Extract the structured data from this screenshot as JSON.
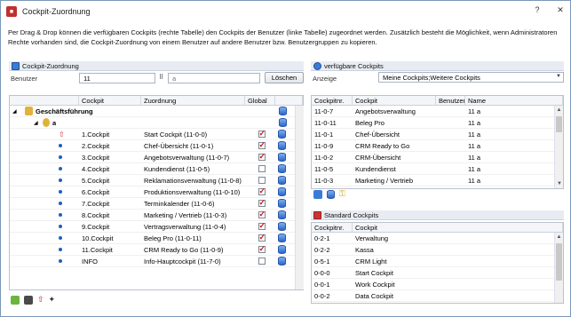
{
  "window": {
    "title": "Cockpit-Zuordnung",
    "help": "?",
    "close": "✕"
  },
  "description": "Per Drag & Drop können die verfügbaren Cockpits (rechte Tabelle) den Cockpits der Benutzer (linke Tabelle) zugeordnet werden. Zusätzlich besteht die Möglichkeit, wenn Administratoren Rechte vorhanden sind, die Cockpit-Zuordnung von einem Benutzer auf andere Benutzer bzw. Benutzergruppen zu kopieren.",
  "left": {
    "panel_title": "Cockpit-Zuordnung",
    "user_label": "Benutzer",
    "user_value": "11",
    "user_name": "a",
    "delete_button": "Löschen",
    "columns": [
      "Cockpit",
      "Zuordnung",
      "Global"
    ],
    "group": "Geschäftsführung",
    "user_node": "a",
    "rows": [
      {
        "cockpit": "1.Cockpit",
        "zuordnung": "Start Cockpit (11-0-0)",
        "global": true,
        "kind": "up"
      },
      {
        "cockpit": "2.Cockpit",
        "zuordnung": "Chef-Übersicht (11-0-1)",
        "global": true,
        "kind": "dot"
      },
      {
        "cockpit": "3.Cockpit",
        "zuordnung": "Angebotsverwaltung (11-0-7)",
        "global": true,
        "kind": "dot"
      },
      {
        "cockpit": "4.Cockpit",
        "zuordnung": "Kundendienst (11-0-5)",
        "global": false,
        "kind": "dot"
      },
      {
        "cockpit": "5.Cockpit",
        "zuordnung": "Reklamationsverwaltung (11-0-8)",
        "global": false,
        "kind": "dot"
      },
      {
        "cockpit": "6.Cockpit",
        "zuordnung": "Produktionsverwaltung (11-0-10)",
        "global": true,
        "kind": "dot"
      },
      {
        "cockpit": "7.Cockpit",
        "zuordnung": "Terminkalender (11-0-6)",
        "global": true,
        "kind": "dot"
      },
      {
        "cockpit": "8.Cockpit",
        "zuordnung": "Marketing / Vertrieb (11-0-3)",
        "global": true,
        "kind": "dot"
      },
      {
        "cockpit": "9.Cockpit",
        "zuordnung": "Vertragsverwaltung (11-0-4)",
        "global": true,
        "kind": "dot"
      },
      {
        "cockpit": "10.Cockpit",
        "zuordnung": "Beleg Pro (11-0-11)",
        "global": true,
        "kind": "dot"
      },
      {
        "cockpit": "11.Cockpit",
        "zuordnung": "CRM Ready to Go (11-0-9)",
        "global": true,
        "kind": "dot"
      },
      {
        "cockpit": "INFO",
        "zuordnung": "Info-Hauptcockpit (11-7-0)",
        "global": false,
        "kind": "dot"
      }
    ]
  },
  "right": {
    "panel_title": "verfügbare Cockpits",
    "anzeige_label": "Anzeige",
    "anzeige_value": "Meine Cockpits;Weitere Cockpits",
    "columns": [
      "Cockpitnr.",
      "Cockpit",
      "Benutzer",
      "Name"
    ],
    "rows": [
      {
        "nr": "11-0-7",
        "cockpit": "Angebotsverwaltung",
        "benutzer": "",
        "name": "11 a"
      },
      {
        "nr": "11-0-11",
        "cockpit": "Beleg Pro",
        "benutzer": "",
        "name": "11 a"
      },
      {
        "nr": "11-0-1",
        "cockpit": "Chef-Übersicht",
        "benutzer": "",
        "name": "11 a"
      },
      {
        "nr": "11-0-9",
        "cockpit": "CRM Ready to Go",
        "benutzer": "",
        "name": "11 a"
      },
      {
        "nr": "11-0-2",
        "cockpit": "CRM-Übersicht",
        "benutzer": "",
        "name": "11 a"
      },
      {
        "nr": "11-0-5",
        "cockpit": "Kundendienst",
        "benutzer": "",
        "name": "11 a"
      },
      {
        "nr": "11-0-3",
        "cockpit": "Marketing / Vertrieb",
        "benutzer": "",
        "name": "11 a"
      }
    ],
    "std_title": "Standard Cockpits",
    "std_columns": [
      "Cockpitnr.",
      "Cockpit"
    ],
    "std_rows": [
      {
        "nr": "0-2-1",
        "cockpit": "Verwaltung"
      },
      {
        "nr": "0-2-2",
        "cockpit": "Kassa"
      },
      {
        "nr": "0-5-1",
        "cockpit": "CRM Light"
      },
      {
        "nr": "0-0-0",
        "cockpit": "Start Cockpit"
      },
      {
        "nr": "0-0-1",
        "cockpit": "Work Cockpit"
      },
      {
        "nr": "0-0-2",
        "cockpit": "Data Cockpit"
      }
    ]
  },
  "colors": {
    "accent": "#3a7bd5",
    "check": "#cc1111",
    "header": "#e8ecf2"
  }
}
